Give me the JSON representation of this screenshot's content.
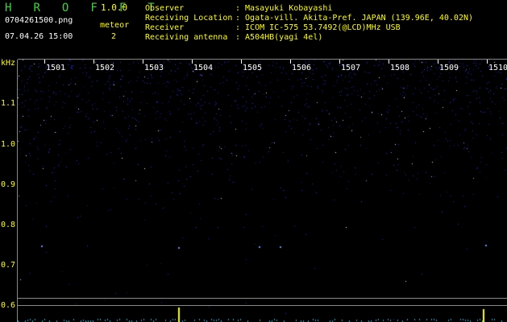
{
  "app": {
    "name": "H R O F F T",
    "version": "1.0.0",
    "filename": "0704261500.png",
    "datetime": "07.04.26 15:00",
    "meteor_label": "meteor",
    "meteor_count": "2"
  },
  "info": {
    "labels": [
      "Observer",
      "Receiving Location",
      "Receiver",
      "Receiving antenna"
    ],
    "values": [
      ": Masayuki Kobayashi",
      ": Ogata-vill. Akita-Pref. JAPAN (139.96E, 40.02N)",
      ": ICOM IC-575 53.7492(@LCD)MHz USB",
      ": A504HB(yagi 4el)"
    ]
  },
  "axis": {
    "unit": "kHz",
    "y_labels": [
      "1.1",
      "1.0",
      "0.9",
      "0.8",
      "0.7",
      "0.6"
    ],
    "x_labels": [
      "1501",
      "1502",
      "1503",
      "1504",
      "1505",
      "1506",
      "1507",
      "1508",
      "1509",
      "1510"
    ]
  },
  "colors": {
    "title": "#3fd23f",
    "label_text": "#ffff00",
    "value_text": "#ffffff",
    "noise": "#1a2cff",
    "meteor_echo": "#ffff00",
    "background": "#000000"
  }
}
